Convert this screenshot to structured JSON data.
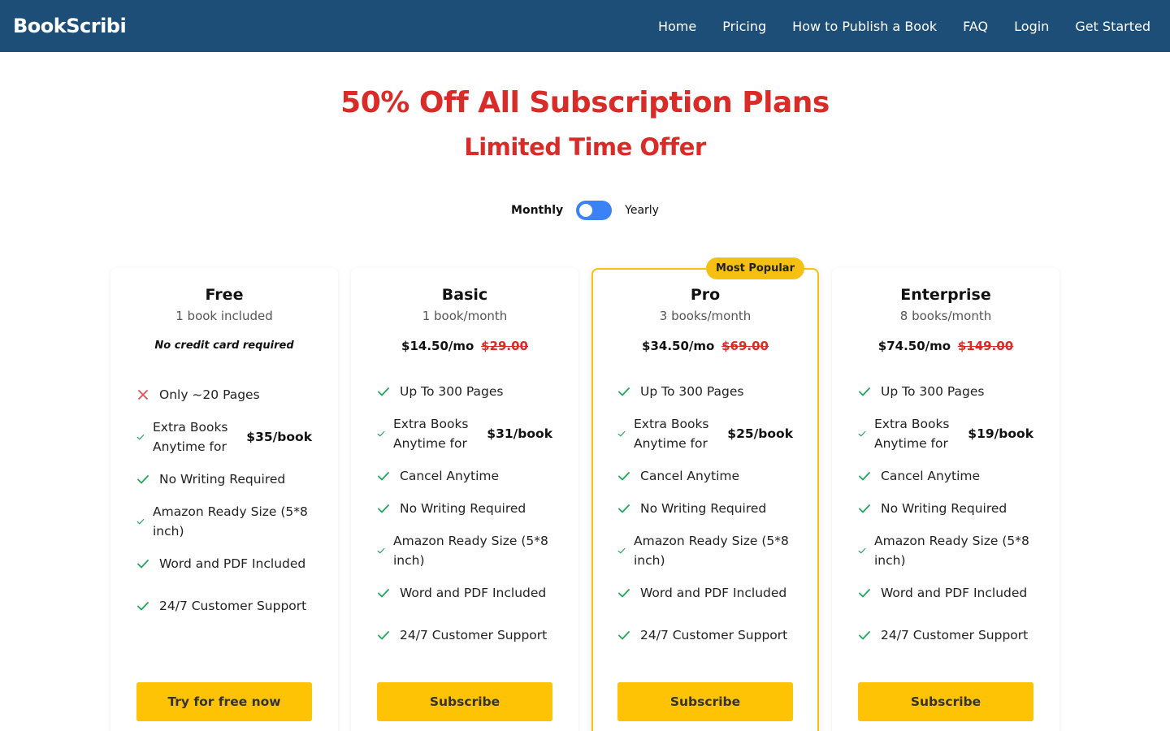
{
  "nav": {
    "brand": "BookScribi",
    "links": [
      "Home",
      "Pricing",
      "How to Publish a Book",
      "FAQ",
      "Login",
      "Get Started"
    ]
  },
  "hero": {
    "headline": "50% Off All Subscription Plans",
    "subline": "Limited Time Offer"
  },
  "billing_toggle": {
    "left_label": "Monthly",
    "right_label": "Yearly",
    "selected": "Monthly"
  },
  "colors": {
    "nav_bg": "#1c4e78",
    "headline_red": "#d92b27",
    "accent_yellow": "#fdc304",
    "toggle_blue": "#3b82f6",
    "check_green": "#22a55a",
    "cross_red": "#e05252"
  },
  "plans": [
    {
      "name": "Free",
      "books": "1 book included",
      "note": "No credit card required",
      "price_now": "",
      "price_old": "",
      "features": [
        {
          "type": "cross",
          "text": "Only ~20 Pages"
        },
        {
          "type": "check",
          "text": "Extra Books Anytime for",
          "extra": "$35/book"
        },
        {
          "type": "check",
          "text": "No Writing Required"
        },
        {
          "type": "check",
          "text": "Amazon Ready Size (5*8 inch)"
        },
        {
          "type": "check",
          "text": "Word and PDF Included"
        },
        {
          "type": "check",
          "text": "24/7 Customer Support"
        }
      ],
      "cta": "Try for free now"
    },
    {
      "name": "Basic",
      "books": "1 book/month",
      "price_now": "$14.50/mo",
      "price_old": "$29.00",
      "features": [
        {
          "type": "check",
          "text": "Up To 300 Pages"
        },
        {
          "type": "check",
          "text": "Extra Books Anytime for",
          "extra": "$31/book"
        },
        {
          "type": "check",
          "text": "Cancel Anytime"
        },
        {
          "type": "check",
          "text": "No Writing Required"
        },
        {
          "type": "check",
          "text": "Amazon Ready Size (5*8 inch)"
        },
        {
          "type": "check",
          "text": "Word and PDF Included"
        },
        {
          "type": "check",
          "text": "24/7 Customer Support"
        }
      ],
      "cta": "Subscribe"
    },
    {
      "name": "Pro",
      "books": "3 books/month",
      "badge": "Most Popular",
      "price_now": "$34.50/mo",
      "price_old": "$69.00",
      "features": [
        {
          "type": "check",
          "text": "Up To 300 Pages"
        },
        {
          "type": "check",
          "text": "Extra Books Anytime for",
          "extra": "$25/book"
        },
        {
          "type": "check",
          "text": "Cancel Anytime"
        },
        {
          "type": "check",
          "text": "No Writing Required"
        },
        {
          "type": "check",
          "text": "Amazon Ready Size (5*8 inch)"
        },
        {
          "type": "check",
          "text": "Word and PDF Included"
        },
        {
          "type": "check",
          "text": "24/7 Customer Support"
        }
      ],
      "cta": "Subscribe"
    },
    {
      "name": "Enterprise",
      "books": "8 books/month",
      "price_now": "$74.50/mo",
      "price_old": "$149.00",
      "features": [
        {
          "type": "check",
          "text": "Up To 300 Pages"
        },
        {
          "type": "check",
          "text": "Extra Books Anytime for",
          "extra": "$19/book"
        },
        {
          "type": "check",
          "text": "Cancel Anytime"
        },
        {
          "type": "check",
          "text": "No Writing Required"
        },
        {
          "type": "check",
          "text": "Amazon Ready Size (5*8 inch)"
        },
        {
          "type": "check",
          "text": "Word and PDF Included"
        },
        {
          "type": "check",
          "text": "24/7 Customer Support"
        }
      ],
      "cta": "Subscribe"
    }
  ]
}
